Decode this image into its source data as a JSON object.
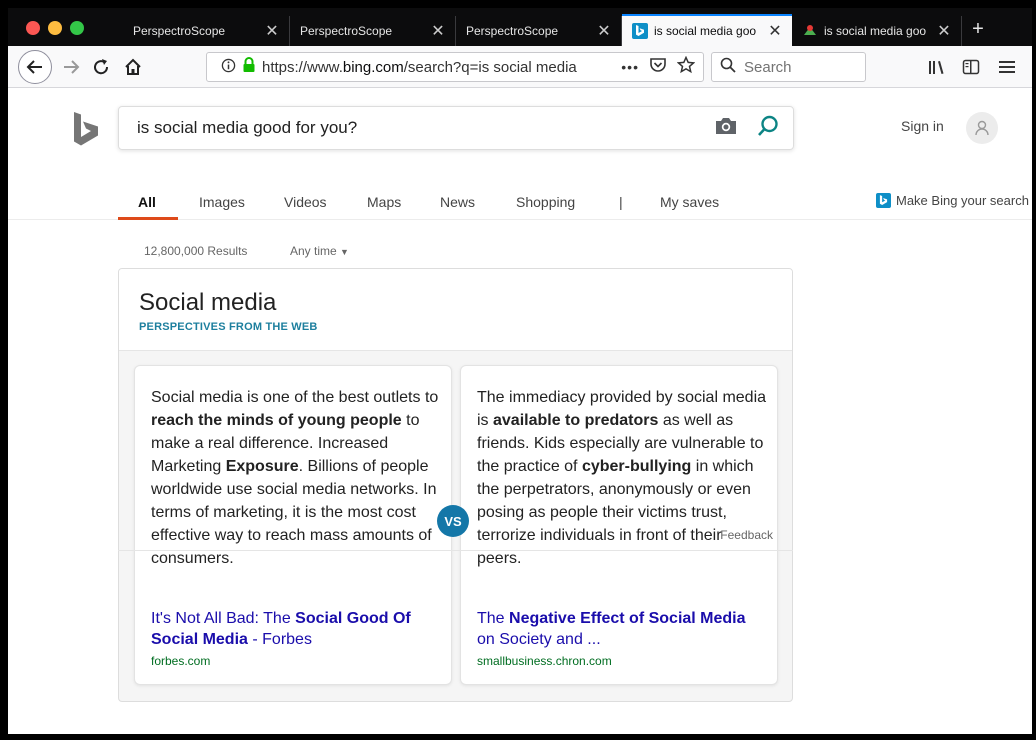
{
  "browser": {
    "tabs": [
      {
        "label": "PerspectroScope",
        "active": false
      },
      {
        "label": "PerspectroScope",
        "active": false
      },
      {
        "label": "PerspectroScope",
        "active": false
      },
      {
        "label": "is social media goo",
        "active": true
      },
      {
        "label": "is social media goo",
        "active": false
      }
    ],
    "url": {
      "prefix": "https://www.",
      "domain": "bing.com",
      "path": "/search?q=is social media"
    },
    "search_placeholder": "Search",
    "icons": [
      "back-arrow-icon",
      "forward-arrow-icon",
      "reload-icon",
      "home-icon",
      "info-icon",
      "lock-icon",
      "more-icon",
      "pocket-icon",
      "star-icon",
      "search-icon",
      "library-icon",
      "sidebar-icon",
      "menu-icon"
    ]
  },
  "bing": {
    "query": "is social media good for you?",
    "sign_in": "Sign in",
    "scopes": [
      "All",
      "Images",
      "Videos",
      "Maps",
      "News",
      "Shopping",
      "|",
      "My saves"
    ],
    "make_bing": "Make Bing your search",
    "results_count": "12,800,000 Results",
    "any_time": "Any time",
    "accent": "#de4a1a",
    "brand": "#0e8fc7"
  },
  "perspectives": {
    "title": "Social media",
    "subtitle": "PERSPECTIVES FROM THE WEB",
    "vs": "VS",
    "feedback": "Feedback",
    "left": {
      "t1": "Social media is one of the best outlets to ",
      "b1": "reach the minds of young people",
      "t2": " to make a real difference. Increased Marketing ",
      "b2": "Exposure",
      "t3": ". Billions of people worldwide use social media networks. In terms of marketing, it is the most cost effective way to reach mass amounts of consumers.",
      "link_pre": "It's Not All Bad: The ",
      "link_bold": "Social Good Of Social Media",
      "link_post": " - Forbes",
      "source": "forbes.com"
    },
    "right": {
      "t1": "The immediacy provided by social media is ",
      "b1": "available to predators",
      "t2": " as well as friends. Kids especially are vulnerable to the practice of ",
      "b2": "cyber-bullying",
      "t3": " in which the perpetrators, anonymously or even posing as people their victims trust, terrorize individuals in front of their peers.",
      "link_pre": "The ",
      "link_bold": "Negative Effect of Social Media",
      "link_post": " on Society and ...",
      "source": "smallbusiness.chron.com"
    }
  }
}
